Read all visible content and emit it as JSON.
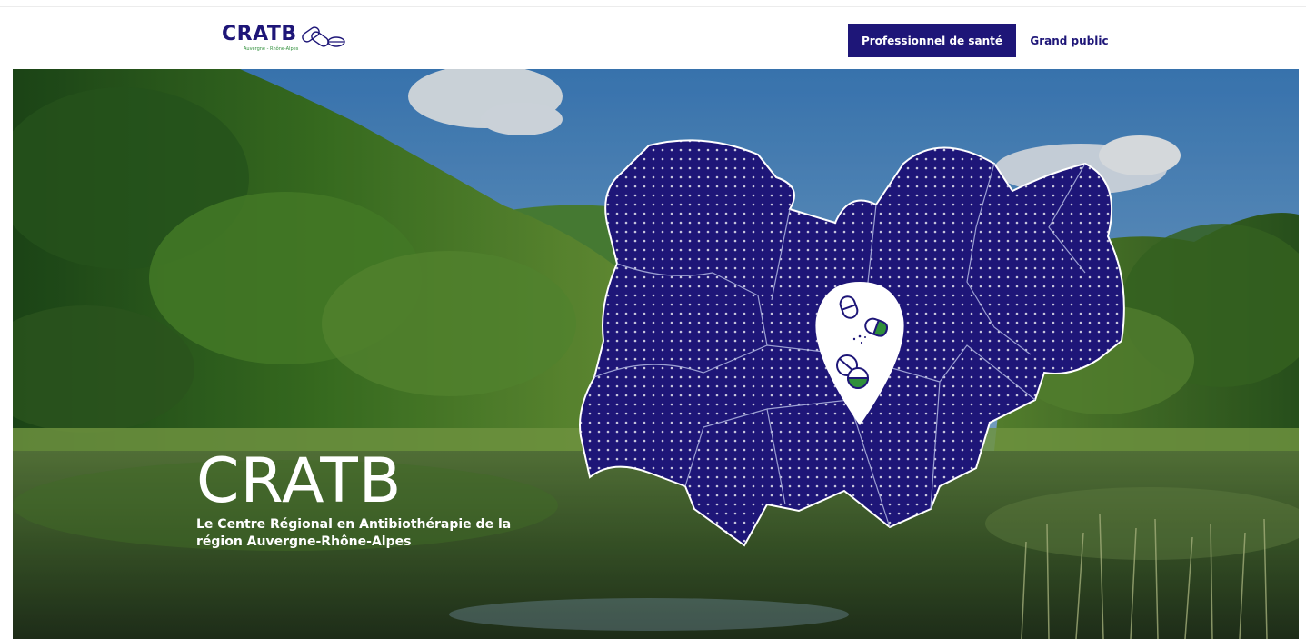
{
  "header": {
    "logo": {
      "text": "CRATB",
      "subtext": "Auvergne - Rhône-Alpes"
    },
    "nav": {
      "professionals": "Professionnel de santé",
      "public": "Grand public"
    }
  },
  "hero": {
    "title": "CRATB",
    "subtitle": "Le Centre Régional en Antibiothérapie de la région Auvergne-Rhône-Alpes"
  },
  "colors": {
    "brand_navy": "#1e1678",
    "brand_green": "#2f8f3a"
  },
  "icons": [
    "pills-icon",
    "location-pin-icon",
    "capsule-icon",
    "tablet-icon"
  ]
}
